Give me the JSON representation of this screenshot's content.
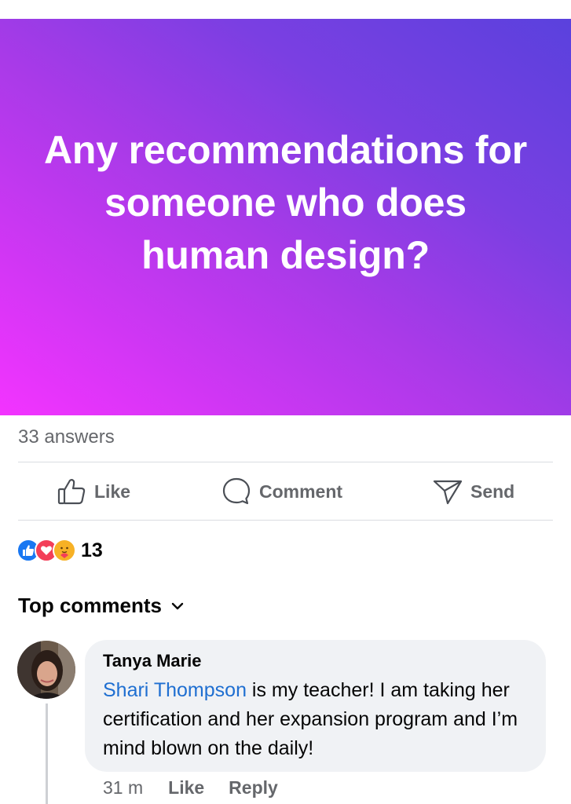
{
  "post": {
    "question": "Any recommendations for someone who does human design?",
    "answers_count": "33 answers"
  },
  "actions": {
    "like": "Like",
    "comment": "Comment",
    "send": "Send"
  },
  "reactions": {
    "icons": [
      "like-icon",
      "love-icon",
      "care-icon"
    ],
    "count": "13"
  },
  "comments_section": {
    "sort_label": "Top comments"
  },
  "comment": {
    "author": "Tanya Marie",
    "mention": "Shari Thompson",
    "text": " is my teacher! I am taking her certification and her expansion program and I’m mind blown on the daily!",
    "time": "31 m",
    "like_label": "Like",
    "reply_label": "Reply"
  },
  "colors": {
    "gradient_start": "#f333ff",
    "gradient_end": "#5a41dd",
    "mention": "#1f6fd1",
    "muted_text": "#65676b",
    "bubble": "#f0f2f5"
  }
}
